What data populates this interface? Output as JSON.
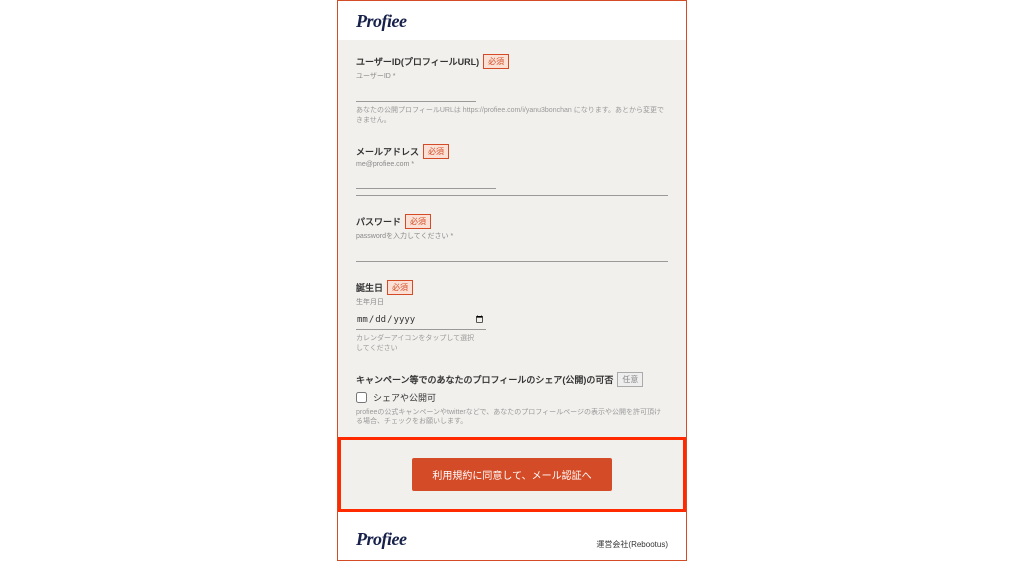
{
  "brand": "Profiee",
  "form": {
    "user_id": {
      "label": "ユーザーID(プロフィールURL)",
      "badge": "必須",
      "sublabel": "ユーザーID *",
      "value": "",
      "help": "あなたの公開プロフィールURLは https://profiee.com/i/yanu3bonchan になります。あとから変更できません。"
    },
    "email": {
      "label": "メールアドレス",
      "badge": "必須",
      "sublabel": "me@profiee.com *",
      "value": ""
    },
    "password": {
      "label": "パスワード",
      "badge": "必須",
      "sublabel": "passwordを入力してください *",
      "value": ""
    },
    "birthdate": {
      "label": "誕生日",
      "badge": "必須",
      "sublabel": "生年月日",
      "value": "",
      "help": "カレンダーアイコンをタップして選択してください"
    },
    "share": {
      "label": "キャンペーン等でのあなたのプロフィールのシェア(公開)の可否",
      "badge": "任意",
      "checkbox_label": "シェアや公開可",
      "help": "profieeの公式キャンペーンやtwitterなどで、あなたのプロフィールページの表示や公開を許可頂ける場合、チェックをお願いします。"
    },
    "submit": "利用規約に同意して、メール認証へ"
  },
  "footer": {
    "company": "運営会社(Rebootus)"
  }
}
